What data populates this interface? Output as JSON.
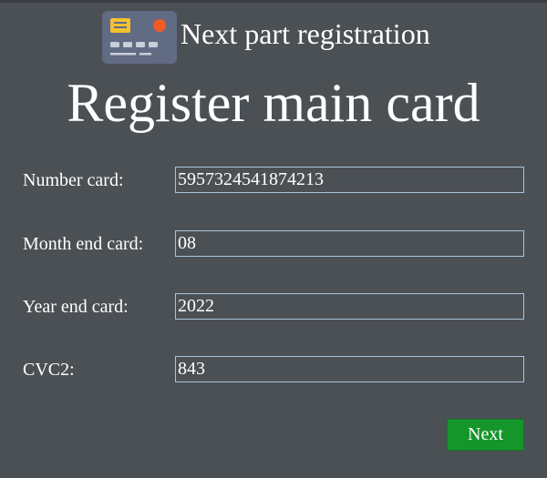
{
  "header": {
    "icon": "credit-card-icon",
    "title": "Next part registration"
  },
  "main": {
    "title": "Register main card"
  },
  "form": {
    "number_card": {
      "label": "Number card:",
      "value": "5957324541874213"
    },
    "month_end": {
      "label": "Month end card:",
      "value": "08"
    },
    "year_end": {
      "label": "Year end card:",
      "value": "2022"
    },
    "cvc2": {
      "label": "CVC2:",
      "value": "843"
    }
  },
  "actions": {
    "next_label": "Next"
  },
  "colors": {
    "background": "#4b5055",
    "input_border": "#a9c4da",
    "next_button": "#15962b",
    "card_icon_body": "#616b84",
    "card_chip": "#f6c12e",
    "card_dot": "#f15a24"
  }
}
